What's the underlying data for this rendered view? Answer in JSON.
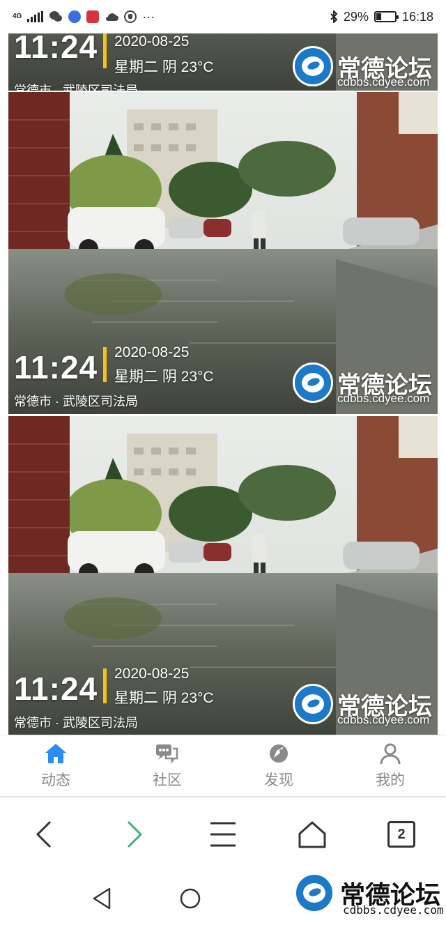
{
  "status_bar": {
    "network": "4G",
    "bluetooth_icon": "bluetooth-icon",
    "battery_text": "29%",
    "battery_level": 0.29,
    "time": "16:18",
    "more": "···"
  },
  "photos": [
    {
      "time": "11:24",
      "date": "2020-08-25",
      "weekday_weather": "星期二 阴 23°C",
      "location": "常德市 · 武陵区司法局",
      "logo_name": "常德论坛",
      "logo_url": "cdbbs.cdyee.com"
    },
    {
      "time": "11:24",
      "date": "2020-08-25",
      "weekday_weather": "星期二 阴 23°C",
      "location": "常德市 · 武陵区司法局",
      "logo_name": "常德论坛",
      "logo_url": "cdbbs.cdyee.com"
    },
    {
      "time": "11:24",
      "date": "2020-08-25",
      "weekday_weather": "星期二 阴 23°C",
      "location": "常德市 · 武陵区司法局",
      "logo_name": "常德论坛",
      "logo_url": "cdbbs.cdyee.com"
    }
  ],
  "colors": {
    "accent": "#2d8cf0",
    "overlay_bar": "#f4c31b",
    "nav_text": "#8a8a8a",
    "forward_arrow": "#3cb371"
  },
  "bottom_nav": {
    "items": [
      {
        "label": "动态",
        "icon": "home-icon",
        "active": true
      },
      {
        "label": "社区",
        "icon": "chat-icon",
        "active": false
      },
      {
        "label": "发现",
        "icon": "rocket-icon",
        "active": false
      },
      {
        "label": "我的",
        "icon": "user-icon",
        "active": false
      }
    ]
  },
  "browser": {
    "back_icon": "back-arrow-icon",
    "forward_icon": "forward-arrow-icon",
    "menu_icon": "menu-icon",
    "home_icon": "home-outline-icon",
    "tab_count": "2"
  },
  "watermark": {
    "name": "常德论坛",
    "url": "cdbbs.cdyee.com"
  }
}
